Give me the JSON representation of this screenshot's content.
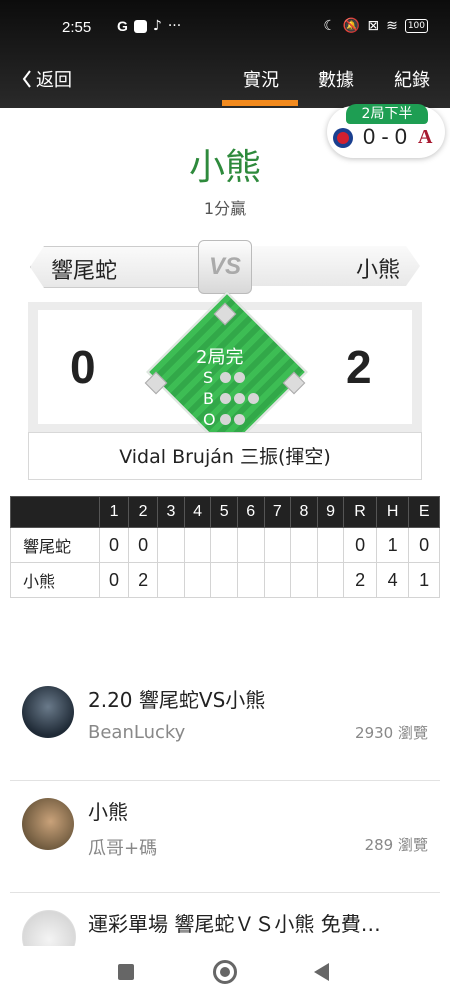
{
  "status_bar": {
    "time": "2:55",
    "left_icons": [
      "G",
      "app-icon",
      "tiktok-icon",
      "···"
    ],
    "battery": "100"
  },
  "header": {
    "back_label": "返回",
    "tabs": [
      {
        "label": "實況",
        "active": true
      },
      {
        "label": "數據",
        "active": false
      },
      {
        "label": "紀錄",
        "active": false
      }
    ]
  },
  "badge": {
    "inning": "2局下半",
    "score": "0 - 0"
  },
  "game": {
    "winner": "小熊",
    "margin": "1分贏",
    "away_team": "響尾蛇",
    "home_team": "小熊",
    "vs": "VS",
    "away_score": "0",
    "home_score": "2",
    "inning_status": "2局完",
    "count_labels": {
      "s": "S",
      "b": "B",
      "o": "O"
    },
    "last_play": "Vidal Bruján 三振(揮空)"
  },
  "linescore": {
    "headers": [
      "",
      "1",
      "2",
      "3",
      "4",
      "5",
      "6",
      "7",
      "8",
      "9",
      "R",
      "H",
      "E"
    ],
    "rows": [
      [
        "響尾蛇",
        "0",
        "0",
        "",
        "",
        "",
        "",
        "",
        "",
        "",
        "0",
        "1",
        "0"
      ],
      [
        "小熊",
        "0",
        "2",
        "",
        "",
        "",
        "",
        "",
        "",
        "",
        "2",
        "4",
        "1"
      ]
    ]
  },
  "posts": [
    {
      "title": "2.20 響尾蛇VS小熊",
      "author": "BeanLucky",
      "views": "2930 瀏覽"
    },
    {
      "title": "小熊",
      "author": "瓜哥+碼",
      "views": "289 瀏覽"
    },
    {
      "title": "運彩單場 響尾蛇ＶＳ小熊  免費…",
      "author": "",
      "views": ""
    }
  ],
  "colors": {
    "accent": "#f28a1e",
    "winner_green": "#2e8a3c",
    "badge_green": "#1e9e53",
    "field_green": "#37b24d"
  }
}
